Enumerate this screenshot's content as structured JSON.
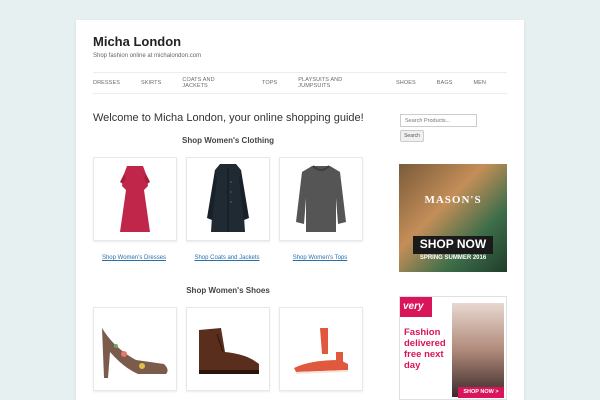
{
  "site": {
    "title": "Micha London",
    "description": "Shop fashion online at michalondon.com"
  },
  "nav": [
    "Dresses",
    "Skirts",
    "Coats and Jackets",
    "Tops",
    "Playsuits and Jumpsuits",
    "Shoes",
    "Bags",
    "Men"
  ],
  "main": {
    "welcome": "Welcome to Micha London, your online shopping guide!",
    "clothing_heading": "Shop Women's Clothing",
    "clothing_links": [
      "Shop Women's Dresses",
      "Shop Coats and Jackets",
      "Shop Women's Tops"
    ],
    "shoes_heading": "Shop Women's Shoes"
  },
  "sidebar": {
    "search_placeholder": "Search Products...",
    "search_button": "Search",
    "ad1": {
      "brand": "MASON'S",
      "cta": "SHOP NOW",
      "season": "SPRING SUMMER 2016"
    },
    "ad2": {
      "brand": "very",
      "tagline_1": "Fashion",
      "tagline_2": "delivered",
      "tagline_3": "free next",
      "tagline_4": "day",
      "cta": "SHOP NOW >"
    }
  },
  "colors": {
    "link": "#2a6fa8",
    "dress": "#c0264a",
    "coat": "#1f2a33",
    "top": "#555555",
    "very": "#d9145a",
    "shoe_red": "#e0583e",
    "boot": "#5a2e1c"
  }
}
